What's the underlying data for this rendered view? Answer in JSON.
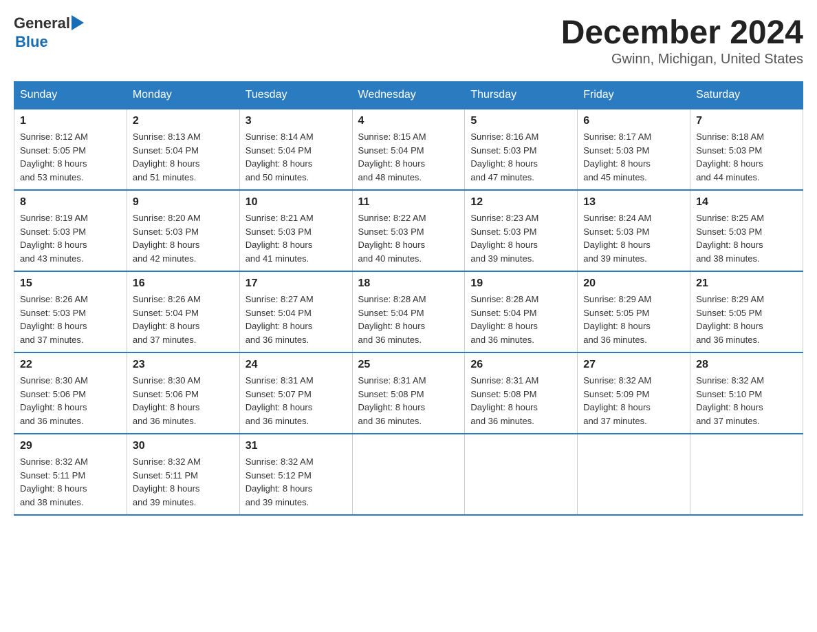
{
  "header": {
    "logo_general": "General",
    "logo_blue": "Blue",
    "month_title": "December 2024",
    "location": "Gwinn, Michigan, United States"
  },
  "days_of_week": [
    "Sunday",
    "Monday",
    "Tuesday",
    "Wednesday",
    "Thursday",
    "Friday",
    "Saturday"
  ],
  "weeks": [
    [
      {
        "day": "1",
        "sunrise": "8:12 AM",
        "sunset": "5:05 PM",
        "daylight": "8 hours and 53 minutes."
      },
      {
        "day": "2",
        "sunrise": "8:13 AM",
        "sunset": "5:04 PM",
        "daylight": "8 hours and 51 minutes."
      },
      {
        "day": "3",
        "sunrise": "8:14 AM",
        "sunset": "5:04 PM",
        "daylight": "8 hours and 50 minutes."
      },
      {
        "day": "4",
        "sunrise": "8:15 AM",
        "sunset": "5:04 PM",
        "daylight": "8 hours and 48 minutes."
      },
      {
        "day": "5",
        "sunrise": "8:16 AM",
        "sunset": "5:03 PM",
        "daylight": "8 hours and 47 minutes."
      },
      {
        "day": "6",
        "sunrise": "8:17 AM",
        "sunset": "5:03 PM",
        "daylight": "8 hours and 45 minutes."
      },
      {
        "day": "7",
        "sunrise": "8:18 AM",
        "sunset": "5:03 PM",
        "daylight": "8 hours and 44 minutes."
      }
    ],
    [
      {
        "day": "8",
        "sunrise": "8:19 AM",
        "sunset": "5:03 PM",
        "daylight": "8 hours and 43 minutes."
      },
      {
        "day": "9",
        "sunrise": "8:20 AM",
        "sunset": "5:03 PM",
        "daylight": "8 hours and 42 minutes."
      },
      {
        "day": "10",
        "sunrise": "8:21 AM",
        "sunset": "5:03 PM",
        "daylight": "8 hours and 41 minutes."
      },
      {
        "day": "11",
        "sunrise": "8:22 AM",
        "sunset": "5:03 PM",
        "daylight": "8 hours and 40 minutes."
      },
      {
        "day": "12",
        "sunrise": "8:23 AM",
        "sunset": "5:03 PM",
        "daylight": "8 hours and 39 minutes."
      },
      {
        "day": "13",
        "sunrise": "8:24 AM",
        "sunset": "5:03 PM",
        "daylight": "8 hours and 39 minutes."
      },
      {
        "day": "14",
        "sunrise": "8:25 AM",
        "sunset": "5:03 PM",
        "daylight": "8 hours and 38 minutes."
      }
    ],
    [
      {
        "day": "15",
        "sunrise": "8:26 AM",
        "sunset": "5:03 PM",
        "daylight": "8 hours and 37 minutes."
      },
      {
        "day": "16",
        "sunrise": "8:26 AM",
        "sunset": "5:04 PM",
        "daylight": "8 hours and 37 minutes."
      },
      {
        "day": "17",
        "sunrise": "8:27 AM",
        "sunset": "5:04 PM",
        "daylight": "8 hours and 36 minutes."
      },
      {
        "day": "18",
        "sunrise": "8:28 AM",
        "sunset": "5:04 PM",
        "daylight": "8 hours and 36 minutes."
      },
      {
        "day": "19",
        "sunrise": "8:28 AM",
        "sunset": "5:04 PM",
        "daylight": "8 hours and 36 minutes."
      },
      {
        "day": "20",
        "sunrise": "8:29 AM",
        "sunset": "5:05 PM",
        "daylight": "8 hours and 36 minutes."
      },
      {
        "day": "21",
        "sunrise": "8:29 AM",
        "sunset": "5:05 PM",
        "daylight": "8 hours and 36 minutes."
      }
    ],
    [
      {
        "day": "22",
        "sunrise": "8:30 AM",
        "sunset": "5:06 PM",
        "daylight": "8 hours and 36 minutes."
      },
      {
        "day": "23",
        "sunrise": "8:30 AM",
        "sunset": "5:06 PM",
        "daylight": "8 hours and 36 minutes."
      },
      {
        "day": "24",
        "sunrise": "8:31 AM",
        "sunset": "5:07 PM",
        "daylight": "8 hours and 36 minutes."
      },
      {
        "day": "25",
        "sunrise": "8:31 AM",
        "sunset": "5:08 PM",
        "daylight": "8 hours and 36 minutes."
      },
      {
        "day": "26",
        "sunrise": "8:31 AM",
        "sunset": "5:08 PM",
        "daylight": "8 hours and 36 minutes."
      },
      {
        "day": "27",
        "sunrise": "8:32 AM",
        "sunset": "5:09 PM",
        "daylight": "8 hours and 37 minutes."
      },
      {
        "day": "28",
        "sunrise": "8:32 AM",
        "sunset": "5:10 PM",
        "daylight": "8 hours and 37 minutes."
      }
    ],
    [
      {
        "day": "29",
        "sunrise": "8:32 AM",
        "sunset": "5:11 PM",
        "daylight": "8 hours and 38 minutes."
      },
      {
        "day": "30",
        "sunrise": "8:32 AM",
        "sunset": "5:11 PM",
        "daylight": "8 hours and 39 minutes."
      },
      {
        "day": "31",
        "sunrise": "8:32 AM",
        "sunset": "5:12 PM",
        "daylight": "8 hours and 39 minutes."
      },
      null,
      null,
      null,
      null
    ]
  ],
  "labels": {
    "sunrise_prefix": "Sunrise: ",
    "sunset_prefix": "Sunset: ",
    "daylight_prefix": "Daylight: "
  }
}
